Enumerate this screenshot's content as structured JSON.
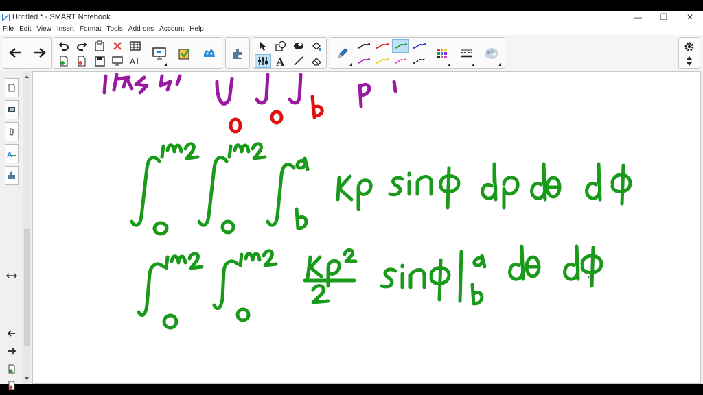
{
  "window": {
    "title": "Untitled * - SMART Notebook",
    "minimize": "—",
    "restore": "❐",
    "close": "✕"
  },
  "menu": [
    "File",
    "Edit",
    "View",
    "Insert",
    "Format",
    "Tools",
    "Add-ons",
    "Account",
    "Help"
  ],
  "toolbar": {
    "pen_colors": [
      "#222222",
      "#e02020",
      "#2a9a3a",
      "#2233cc",
      "#b020b0",
      "#e8d020",
      "#e040c0",
      "#222222"
    ],
    "selected_pen": 2
  },
  "colors": {
    "ink_green": "#1a9a1a",
    "ink_purple": "#9a1aa0",
    "ink_red": "#e01010",
    "accent_blue": "#2a7fd4"
  },
  "icons": [
    "back-arrow-icon",
    "forward-arrow-icon",
    "undo-icon",
    "redo-icon",
    "paste-icon",
    "delete-icon",
    "table-icon",
    "add-page-icon",
    "clear-page-icon",
    "screen-shade-icon",
    "fullscreen-icon",
    "response-icon",
    "activity-builder-icon",
    "addons-icon",
    "select-icon",
    "shapes-icon",
    "eraser-shape-icon",
    "fill-icon",
    "text-icon",
    "lines-icon",
    "magic-pen-icon",
    "pen-icon",
    "color-icon",
    "line-style-icon",
    "properties-icon",
    "settings-icon",
    "move-toolbar-icon"
  ]
}
